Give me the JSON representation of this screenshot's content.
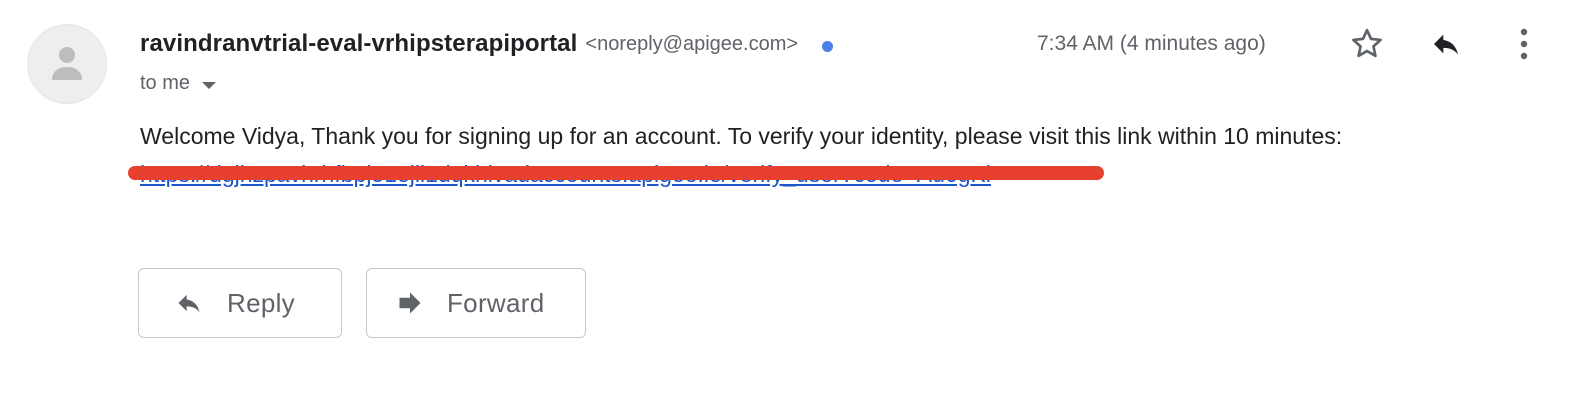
{
  "message": {
    "sender_name": "ravindranvtrial-eval-vrhipsterapiportal",
    "sender_email": "<noreply@apigee.com>",
    "timestamp": "7:34 AM (4 minutes ago)",
    "recipient_label": "to me",
    "body": "Welcome Vidya, Thank you for signing up for an account. To verify your identity, please visit this link within 10 minutes:",
    "link_text": "https://dgjhzpavhrhfbpj51ojli1dqkhivadaccounts.apigee.io/verify_user?code=Au6gKi"
  },
  "actions": {
    "reply_label": "Reply",
    "forward_label": "Forward"
  },
  "icons": {
    "avatar": "person-icon",
    "presence": "presence-dot-icon",
    "star": "star-outline-icon",
    "reply": "reply-icon",
    "more": "more-vert-icon",
    "recipient_caret": "caret-down-icon",
    "forward": "forward-icon"
  },
  "colors": {
    "text_primary": "#202124",
    "text_secondary": "#5f6368",
    "link": "#1a55cc",
    "presence_dot": "#4a80e8",
    "redaction": "#e8402f",
    "button_border": "#c8c8c8"
  }
}
